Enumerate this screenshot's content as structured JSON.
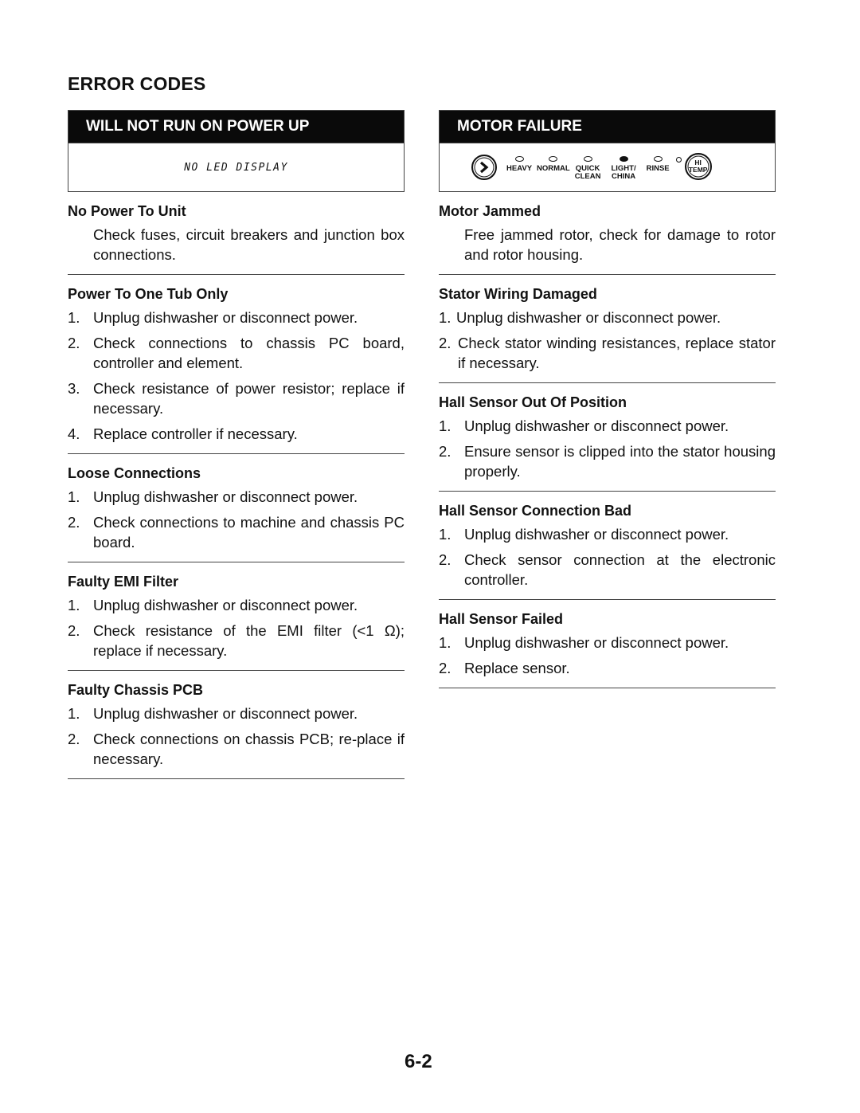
{
  "page": {
    "title": "ERROR CODES",
    "page_number": "6-2"
  },
  "left": {
    "panel": {
      "header": "WILL NOT RUN ON POWER UP",
      "display_text": "NO LED DISPLAY"
    },
    "sections": [
      {
        "title": "No Power To Unit",
        "paragraph": "Check fuses, circuit breakers and junction box connections."
      },
      {
        "title": "Power To One Tub Only",
        "items": [
          {
            "num": "1.",
            "text": "Unplug dishwasher or disconnect power."
          },
          {
            "num": "2.",
            "text": "Check connections to chassis PC board, controller and element."
          },
          {
            "num": "3.",
            "text": "Check resistance of power resistor; replace if necessary."
          },
          {
            "num": "4.",
            "text": "Replace controller if necessary."
          }
        ]
      },
      {
        "title": "Loose Connections",
        "items": [
          {
            "num": "1.",
            "text": "Unplug dishwasher or disconnect power."
          },
          {
            "num": "2.",
            "text": "Check connections to machine and chassis PC board."
          }
        ]
      },
      {
        "title": "Faulty EMI Filter",
        "items": [
          {
            "num": "1.",
            "text": "Unplug dishwasher or disconnect power."
          },
          {
            "num": "2.",
            "text": "Check resistance of the EMI filter (<1 Ω); replace if necessary."
          }
        ]
      },
      {
        "title": "Faulty Chassis PCB",
        "items": [
          {
            "num": "1.",
            "text": "Unplug dishwasher or disconnect power."
          },
          {
            "num": "2.",
            "text": "Check connections on chassis PCB; re-place if necessary."
          }
        ]
      }
    ]
  },
  "right": {
    "panel": {
      "header": "MOTOR FAILURE",
      "controls": {
        "start_icon": "chevron-right-icon",
        "cycles": [
          {
            "label": "HEAVY",
            "lit": false
          },
          {
            "label": "NORMAL",
            "lit": false
          },
          {
            "label": "QUICK CLEAN",
            "line1": "QUICK",
            "line2": "CLEAN",
            "lit": false
          },
          {
            "label": "LIGHT/ CHINA",
            "line1": "LIGHT/",
            "line2": "CHINA",
            "lit": true
          },
          {
            "label": "RINSE",
            "lit": false
          }
        ],
        "hi_temp": {
          "line1": "HI",
          "line2": "TEMP",
          "lit": false
        }
      }
    },
    "sections": [
      {
        "title": "Motor Jammed",
        "paragraph": "Free jammed rotor, check for damage to rotor and rotor housing."
      },
      {
        "title": "Stator Wiring Damaged",
        "items": [
          {
            "num": "1.",
            "text": "Unplug dishwasher or disconnect power."
          },
          {
            "num": "2.",
            "text": "Check stator winding resistances, replace stator if necessary."
          }
        ]
      },
      {
        "title": "Hall Sensor Out Of Position",
        "items": [
          {
            "num": "1.",
            "text": "Unplug dishwasher or disconnect power."
          },
          {
            "num": "2.",
            "text": "Ensure sensor is clipped into the stator housing properly."
          }
        ]
      },
      {
        "title": "Hall Sensor Connection Bad",
        "items": [
          {
            "num": "1.",
            "text": "Unplug dishwasher or disconnect power."
          },
          {
            "num": "2.",
            "text": "Check sensor connection at the electronic controller."
          }
        ]
      },
      {
        "title": "Hall Sensor Failed",
        "items": [
          {
            "num": "1.",
            "text": "Unplug dishwasher or disconnect power."
          },
          {
            "num": "2.",
            "text": "Replace sensor."
          }
        ]
      }
    ]
  }
}
